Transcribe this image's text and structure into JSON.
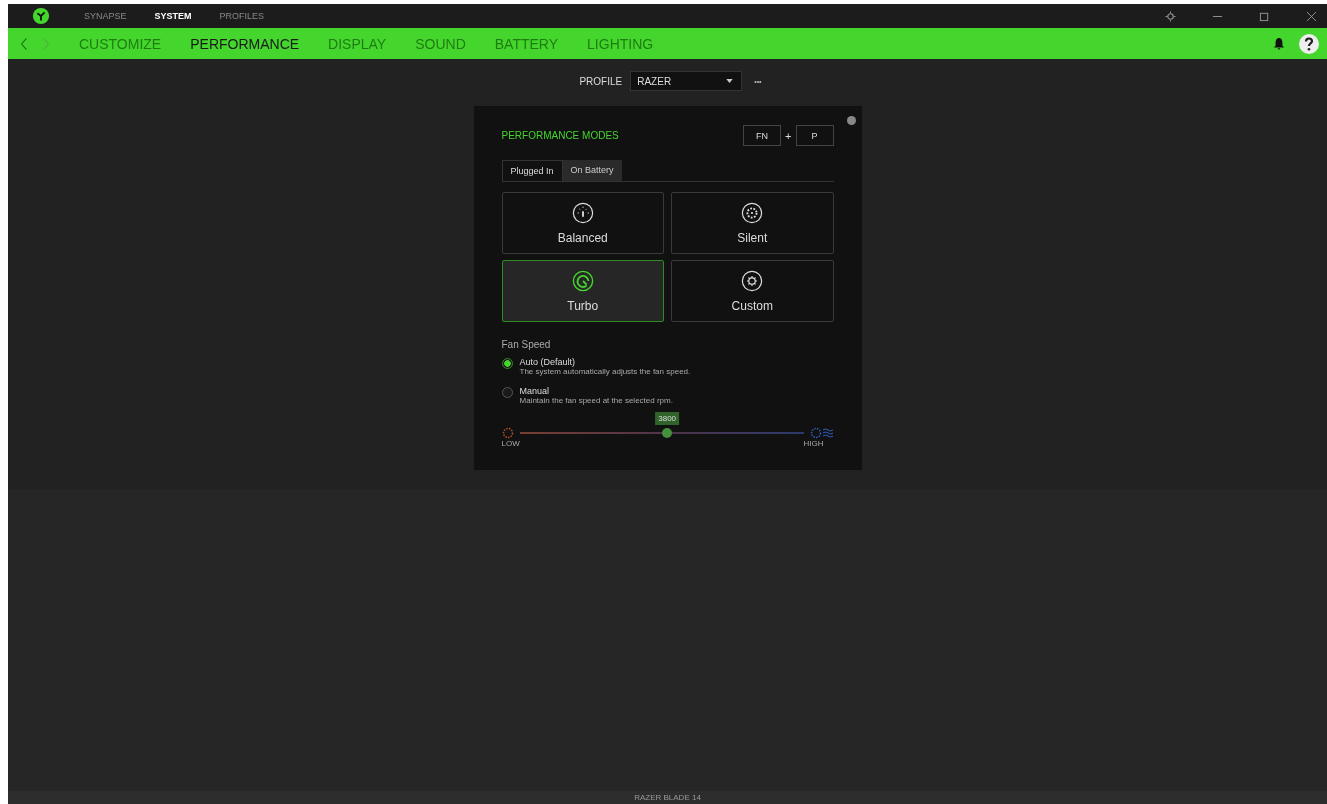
{
  "top_tabs": [
    {
      "label": "SYNAPSE",
      "selected": false
    },
    {
      "label": "SYSTEM",
      "selected": true
    },
    {
      "label": "PROFILES",
      "selected": false
    }
  ],
  "nav_tabs": [
    {
      "label": "CUSTOMIZE",
      "selected": false
    },
    {
      "label": "PERFORMANCE",
      "selected": true
    },
    {
      "label": "DISPLAY",
      "selected": false
    },
    {
      "label": "SOUND",
      "selected": false
    },
    {
      "label": "BATTERY",
      "selected": false
    },
    {
      "label": "LIGHTING",
      "selected": false
    }
  ],
  "profile": {
    "label": "PROFILE",
    "value": "RAZER",
    "more": "•••"
  },
  "panel": {
    "title": "PERFORMANCE MODES",
    "shortcut": [
      "FN",
      "P"
    ],
    "shortcut_joiner": "+",
    "power_tabs": [
      {
        "label": "Plugged In",
        "selected": true
      },
      {
        "label": "On Battery",
        "selected": false
      }
    ],
    "modes": [
      {
        "kind": "gauge",
        "label": "Balanced",
        "selected": false
      },
      {
        "kind": "fan",
        "label": "Silent",
        "selected": false
      },
      {
        "kind": "turbo",
        "label": "Turbo",
        "selected": true
      },
      {
        "kind": "gear",
        "label": "Custom",
        "selected": false
      }
    ],
    "fan_speed": {
      "title": "Fan Speed",
      "options": [
        {
          "label": "Auto (Default)",
          "description": "The system automatically adjusts the fan speed.",
          "selected": true
        },
        {
          "label": "Manual",
          "description": "Maintain the fan speed at the selected rpm.",
          "selected": false
        }
      ],
      "slider": {
        "value": "3800",
        "level": 0.52,
        "disabled": true,
        "low": "LOW",
        "high": "HIGH"
      }
    }
  },
  "status_bar": {
    "device": "RAZER BLADE 14"
  }
}
